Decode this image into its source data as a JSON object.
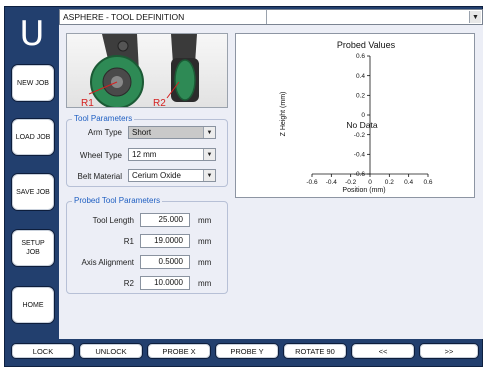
{
  "app": {
    "logo": "U",
    "title": "ASPHERE - TOOL DEFINITION"
  },
  "sidebar": {
    "items": [
      {
        "label": "NEW JOB"
      },
      {
        "label": "LOAD JOB"
      },
      {
        "label": "SAVE JOB"
      },
      {
        "label": "SETUP\nJOB"
      },
      {
        "label": "HOME"
      }
    ]
  },
  "image": {
    "r1_label": "R1",
    "r2_label": "R2"
  },
  "tool_parameters": {
    "title": "Tool Parameters",
    "arm_type": {
      "label": "Arm Type",
      "value": "Short"
    },
    "wheel_type": {
      "label": "Wheel Type",
      "value": "12 mm"
    },
    "belt_material": {
      "label": "Belt Material",
      "value": "Cerium Oxide"
    }
  },
  "probed_parameters": {
    "title": "Probed Tool Parameters",
    "tool_length": {
      "label": "Tool Length",
      "value": "25.000",
      "unit": "mm"
    },
    "r1": {
      "label": "R1",
      "value": "19.0000",
      "unit": "mm"
    },
    "axis_alignment": {
      "label": "Axis Alignment",
      "value": "0.5000",
      "unit": "mm"
    },
    "r2": {
      "label": "R2",
      "value": "10.0000",
      "unit": "mm"
    }
  },
  "chart": {
    "title": "Probed Values",
    "empty_text": "No Data"
  },
  "chart_data": {
    "type": "scatter",
    "title": "Probed Values",
    "xlabel": "Position (mm)",
    "ylabel": "Z Height (mm)",
    "xlim": [
      -0.6,
      0.6
    ],
    "ylim": [
      -0.6,
      0.6
    ],
    "x_ticks": [
      "-0.6",
      "-0.4",
      "-0.2",
      "0",
      "0.2",
      "0.4",
      "0.6"
    ],
    "y_ticks": [
      "0.6",
      "0.4",
      "0.2",
      "0",
      "-0.2",
      "-0.4",
      "-0.6"
    ],
    "series": [],
    "annotation": "No Data"
  },
  "toolbar": {
    "buttons": [
      {
        "label": "LOCK"
      },
      {
        "label": "UNLOCK"
      },
      {
        "label": "PROBE X"
      },
      {
        "label": "PROBE Y"
      },
      {
        "label": "ROTATE 90"
      },
      {
        "label": "<<"
      },
      {
        "label": ">>"
      }
    ]
  },
  "colors": {
    "frame": "#223f6e",
    "content_bg": "#eceef6",
    "group_title": "#1f5fc2",
    "wheel_green": "#2e8a55",
    "label_red": "#d42020"
  }
}
